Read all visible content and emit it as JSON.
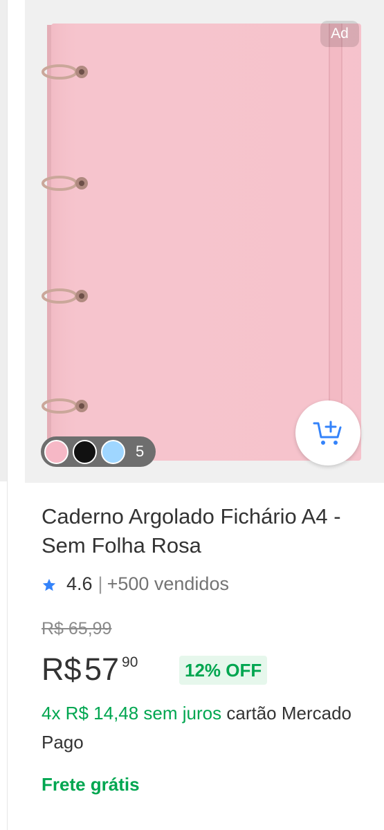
{
  "colors": {
    "accent_blue": "#3483fa",
    "green": "#00a650",
    "discount_bg": "#e6f7ec",
    "text": "#333333",
    "muted": "#737373"
  },
  "product": {
    "image_icon": "pink-a4-binder-image",
    "ad_label": "Ad",
    "color_swatches": [
      {
        "name": "pink-swatch",
        "color": "#f6b8c6"
      },
      {
        "name": "black-swatch",
        "color": "#111111"
      },
      {
        "name": "light-blue-swatch",
        "color": "#9fd6ff"
      }
    ],
    "more_colors_count": "5",
    "cart_icon": "add-to-cart-icon",
    "title": "Caderno Argolado Fichário A4 - Sem Folha Rosa",
    "rating": {
      "icon": "star-icon",
      "value": "4.6",
      "separator": "|",
      "sold": "+500 vendidos"
    },
    "old_price": "R$ 65,99",
    "price": {
      "currency": "R$",
      "integer": "57",
      "cents": "90"
    },
    "discount": "12% OFF",
    "installments": {
      "highlight": "4x R$ 14,48 sem juros",
      "rest": "cartão Mercado Pago"
    },
    "shipping": "Frete grátis"
  }
}
